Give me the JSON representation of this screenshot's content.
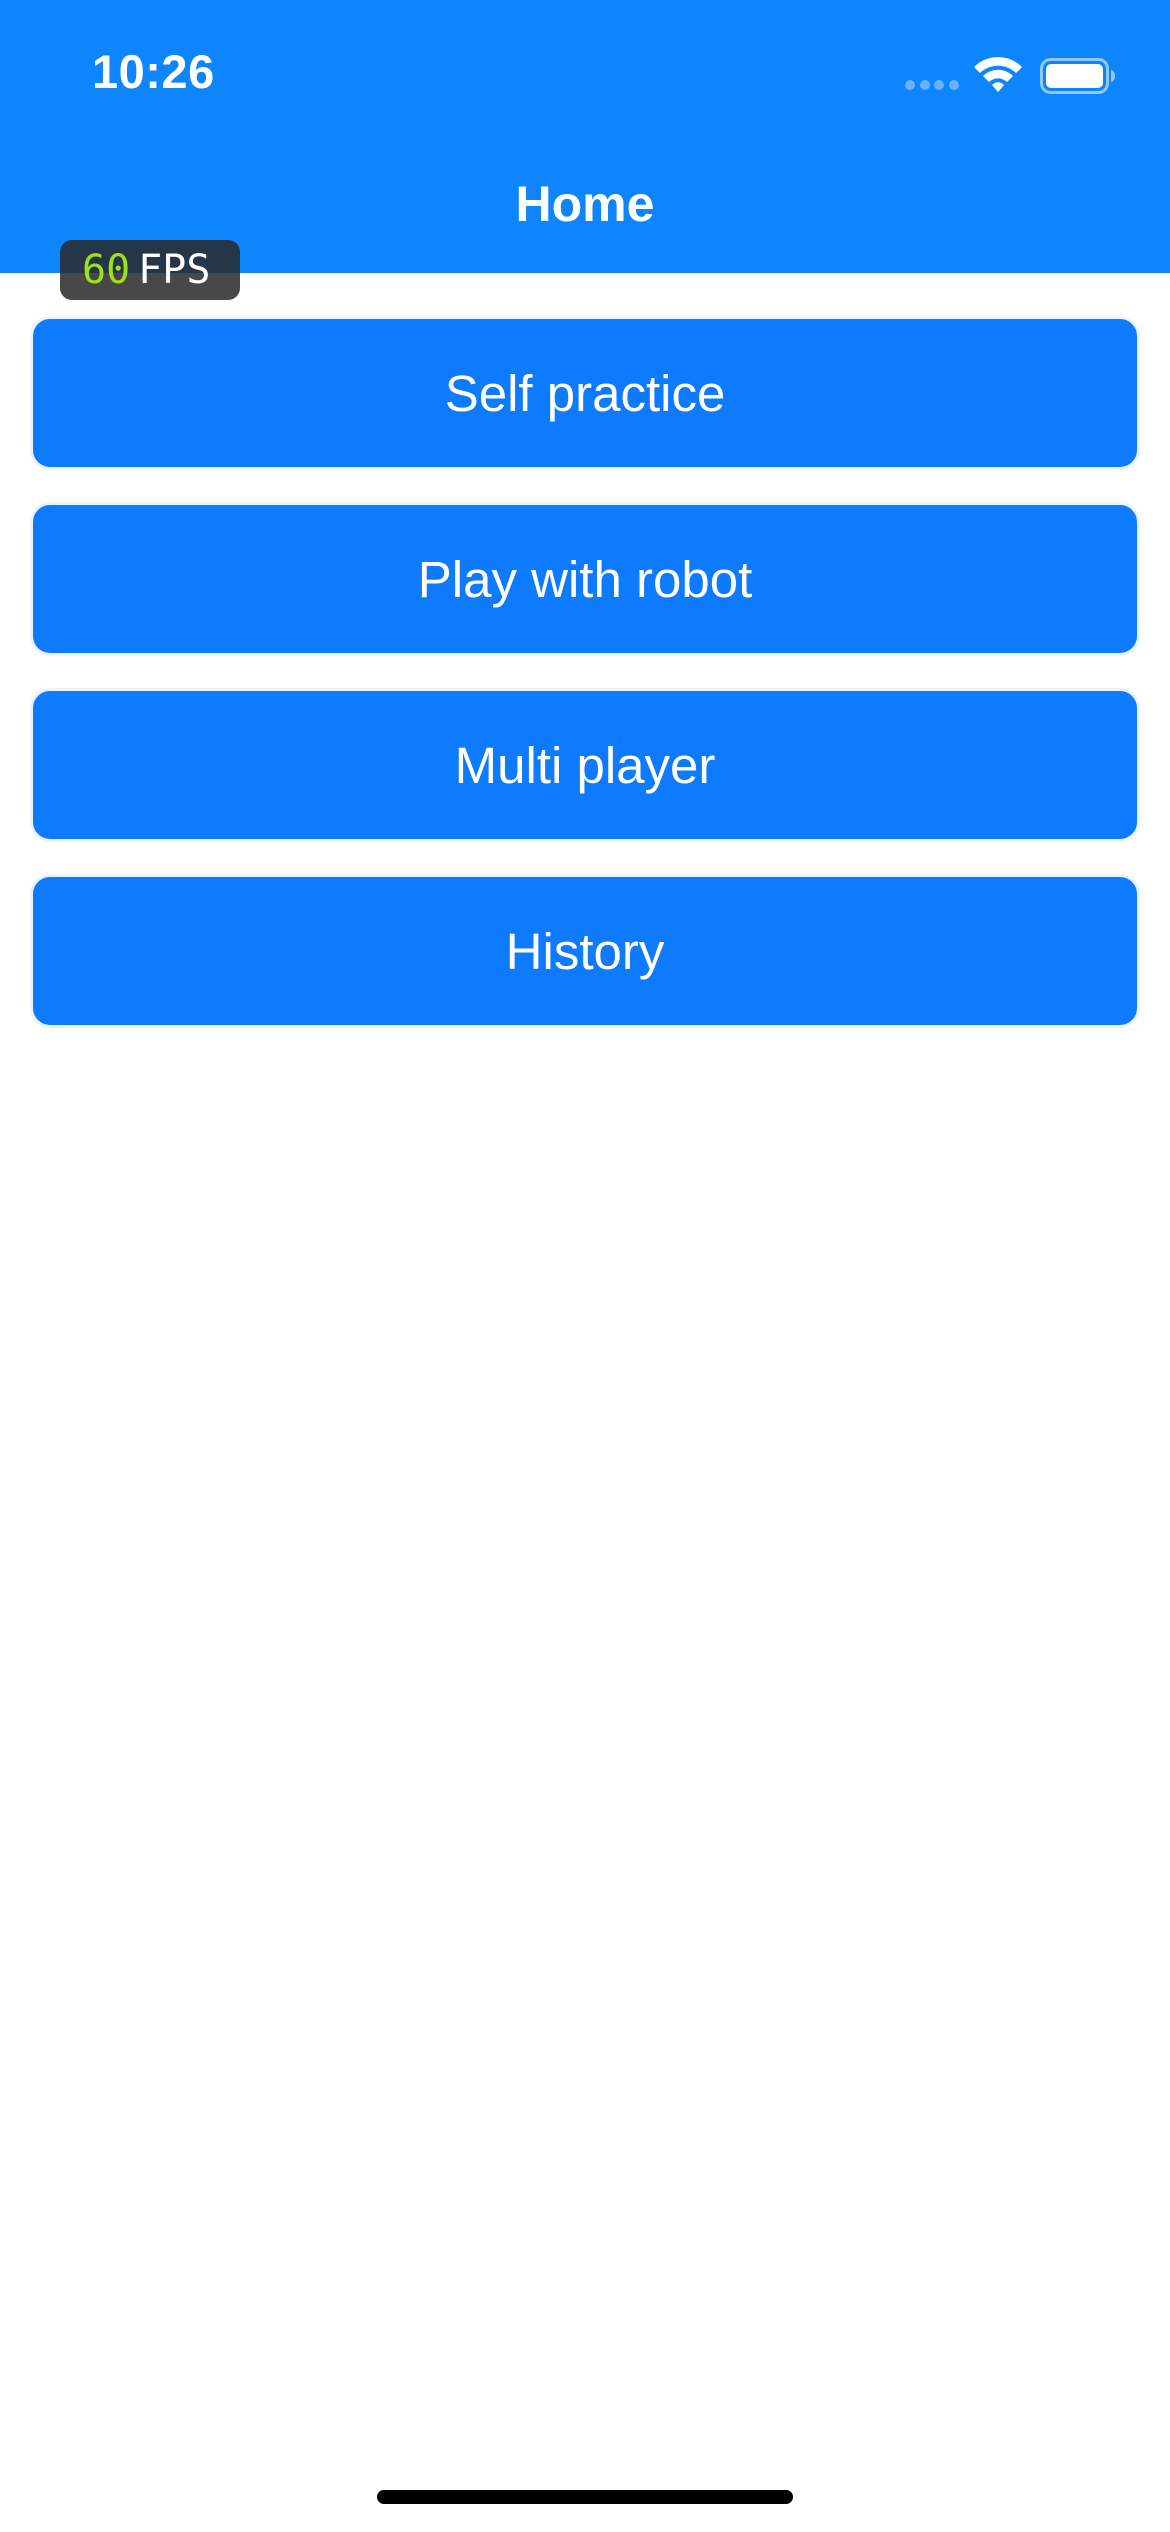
{
  "status_bar": {
    "time": "10:26",
    "icons": [
      "cellular-signal-icon",
      "wifi-icon",
      "battery-icon"
    ]
  },
  "nav": {
    "title": "Home"
  },
  "fps_overlay": {
    "value": "60",
    "unit": "FPS"
  },
  "menu": {
    "items": [
      {
        "label": "Self practice"
      },
      {
        "label": "Play with robot"
      },
      {
        "label": "Multi player"
      },
      {
        "label": "History"
      }
    ]
  },
  "colors": {
    "header_background": "#0e85fb",
    "button_background": "#0e7afe",
    "fps_value": "#9fe01a"
  }
}
